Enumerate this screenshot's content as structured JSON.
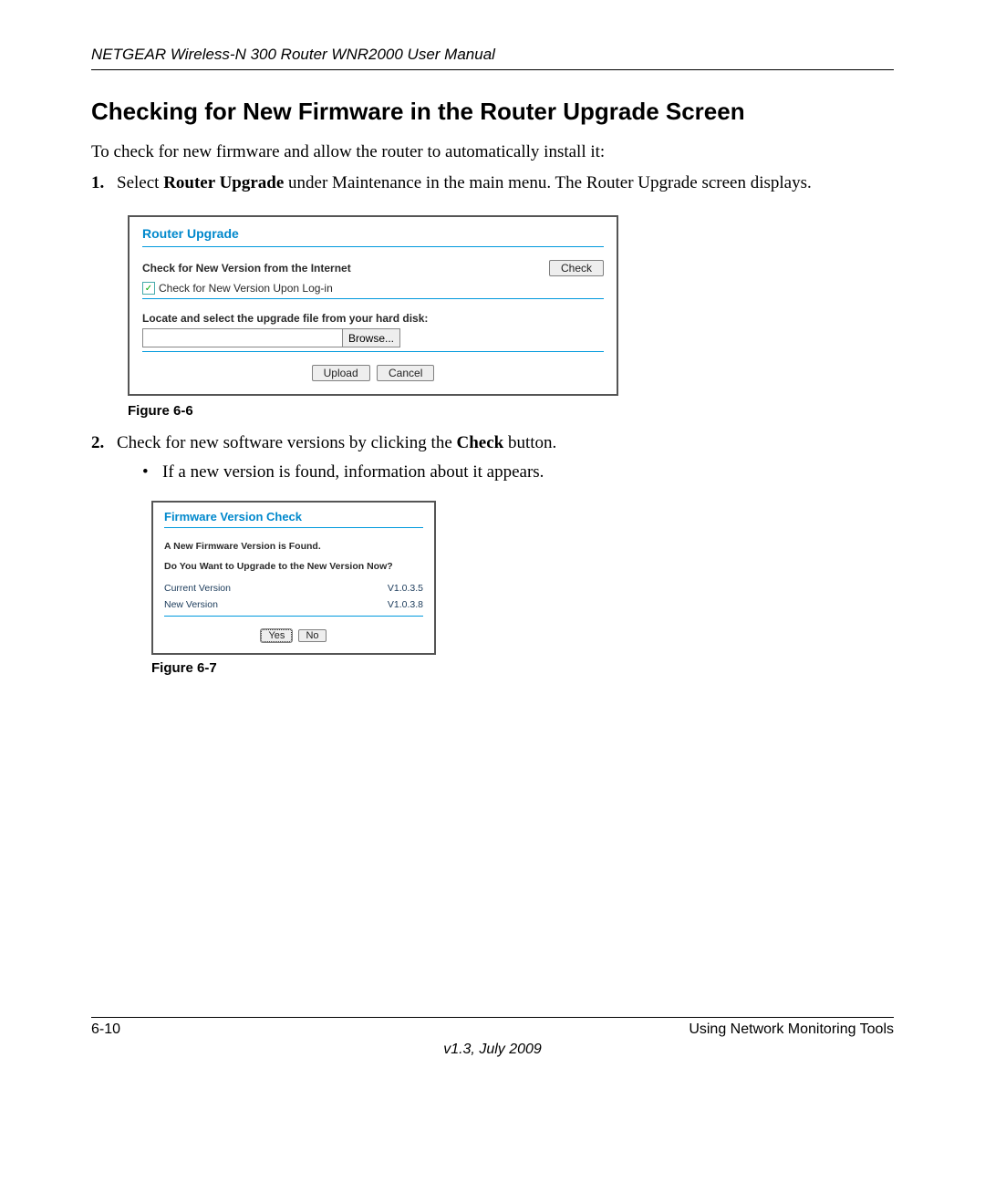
{
  "header": {
    "manual_title": "NETGEAR Wireless-N 300 Router WNR2000 User Manual"
  },
  "section": {
    "title": "Checking for New Firmware in the Router Upgrade Screen",
    "intro": "To check for new firmware and allow the router to automatically install it:"
  },
  "steps": {
    "s1_num": "1.",
    "s1_pre": "Select ",
    "s1_bold": "Router Upgrade",
    "s1_post": " under Maintenance in the main menu. The Router Upgrade screen displays.",
    "s2_num": "2.",
    "s2_pre": "Check for new software versions by clicking the ",
    "s2_bold": "Check",
    "s2_post": " button.",
    "s2_sub1": "If a new version is found, information about it appears."
  },
  "figure1": {
    "caption": "Figure 6-6",
    "panel_title": "Router Upgrade",
    "check_label": "Check for New Version from the Internet",
    "check_button": "Check",
    "checkbox_mark": "✓",
    "checkbox_label": "Check for New Version Upon Log-in",
    "locate_label": "Locate and select the upgrade file from your hard disk:",
    "browse": "Browse...",
    "upload": "Upload",
    "cancel": "Cancel"
  },
  "figure2": {
    "caption": "Figure 6-7",
    "panel_title": "Firmware Version Check",
    "found": "A New Firmware Version is Found.",
    "question": "Do You Want to Upgrade to the New Version Now?",
    "cur_label": "Current Version",
    "cur_val": "V1.0.3.5",
    "new_label": "New Version",
    "new_val": "V1.0.3.8",
    "yes": "Yes",
    "no": "No"
  },
  "footer": {
    "page_num": "6-10",
    "section_name": "Using Network Monitoring Tools",
    "version": "v1.3, July 2009"
  }
}
